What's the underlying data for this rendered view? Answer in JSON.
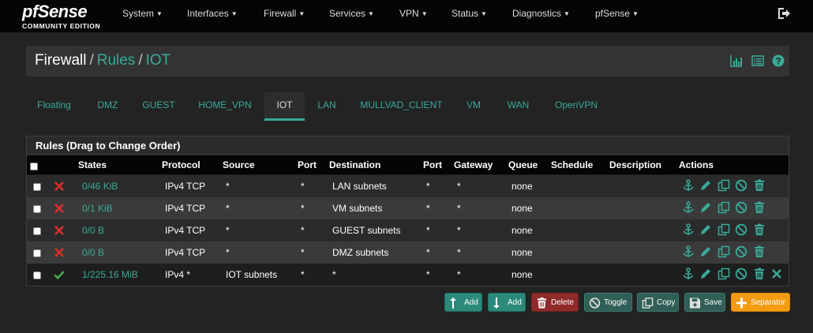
{
  "brand": {
    "logo": "pfSense",
    "edition": "COMMUNITY EDITION"
  },
  "nav": [
    {
      "label": "System"
    },
    {
      "label": "Interfaces"
    },
    {
      "label": "Firewall"
    },
    {
      "label": "Services"
    },
    {
      "label": "VPN"
    },
    {
      "label": "Status"
    },
    {
      "label": "Diagnostics"
    },
    {
      "label": "pfSense"
    }
  ],
  "breadcrumb": {
    "root": "Firewall",
    "sep": "/",
    "level2": "Rules",
    "level3": "IOT"
  },
  "header_icons": [
    "chart-icon",
    "list-icon",
    "help-icon"
  ],
  "tabs": [
    {
      "label": "Floating"
    },
    {
      "label": "DMZ"
    },
    {
      "label": "GUEST"
    },
    {
      "label": "HOME_VPN"
    },
    {
      "label": "IOT",
      "active": true
    },
    {
      "label": "LAN"
    },
    {
      "label": "MULLVAD_CLIENT"
    },
    {
      "label": "VM"
    },
    {
      "label": "WAN"
    },
    {
      "label": "OpenVPN"
    }
  ],
  "panel": {
    "title": "Rules (Drag to Change Order)"
  },
  "columns": {
    "states": "States",
    "protocol": "Protocol",
    "source": "Source",
    "port": "Port",
    "destination": "Destination",
    "dport": "Port",
    "gateway": "Gateway",
    "queue": "Queue",
    "schedule": "Schedule",
    "description": "Description",
    "actions": "Actions"
  },
  "rules": [
    {
      "status": "blocked",
      "states": "0/46 KiB",
      "protocol": "IPv4 TCP",
      "source": "*",
      "port": "*",
      "destination": "LAN subnets",
      "dport": "*",
      "gateway": "*",
      "queue": "none",
      "schedule": "",
      "description": ""
    },
    {
      "status": "blocked",
      "states": "0/1 KiB",
      "protocol": "IPv4 TCP",
      "source": "*",
      "port": "*",
      "destination": "VM subnets",
      "dport": "*",
      "gateway": "*",
      "queue": "none",
      "schedule": "",
      "description": ""
    },
    {
      "status": "blocked",
      "states": "0/0 B",
      "protocol": "IPv4 TCP",
      "source": "*",
      "port": "*",
      "destination": "GUEST subnets",
      "dport": "*",
      "gateway": "*",
      "queue": "none",
      "schedule": "",
      "description": ""
    },
    {
      "status": "blocked",
      "states": "0/0 B",
      "protocol": "IPv4 TCP",
      "source": "*",
      "port": "*",
      "destination": "DMZ subnets",
      "dport": "*",
      "gateway": "*",
      "queue": "none",
      "schedule": "",
      "description": ""
    },
    {
      "status": "pass",
      "states": "1/225.16 MiB",
      "protocol": "IPv4 *",
      "source": "IOT subnets",
      "port": "*",
      "destination": "*",
      "dport": "*",
      "gateway": "*",
      "queue": "none",
      "schedule": "",
      "description": ""
    }
  ],
  "buttons": {
    "add_top": "Add",
    "add_bottom": "Add",
    "delete": "Delete",
    "toggle": "Toggle",
    "copy": "Copy",
    "save": "Save",
    "separator": "Separator"
  },
  "colors": {
    "accent": "#3aa998",
    "danger": "#d9302c",
    "success": "#4cae4c",
    "warning": "#f39c12"
  }
}
